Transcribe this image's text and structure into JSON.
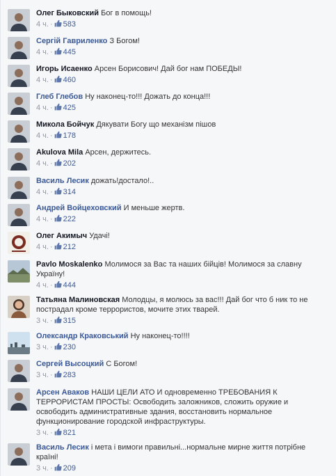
{
  "colors": {
    "link": "#3b5998",
    "text": "#333333",
    "meta": "#9197a3",
    "background": "#f6f7f8"
  },
  "comments": [
    {
      "author": "Олег Быковский",
      "text": "Бог в помощь!",
      "time": "4 ч.",
      "likes": "583",
      "avatar": "man-avatar"
    },
    {
      "author": "Сергій Гавриленко",
      "text": "З Богом!",
      "time": "4 ч.",
      "likes": "445",
      "avatar": "man-avatar"
    },
    {
      "author": "Игорь Исаенко",
      "text": "Арсен Борисович! Дай бог нам ПОБЕДЫ!",
      "time": "4 ч.",
      "likes": "460",
      "avatar": "man-avatar"
    },
    {
      "author": "Глеб Глебов",
      "text": "Ну наконец-то!!! Дожать до конца!!!",
      "time": "4 ч.",
      "likes": "425",
      "avatar": "man-avatar"
    },
    {
      "author": "Микола Бойчук",
      "text": "Дякувати Богу що механізм пішов",
      "time": "4 ч.",
      "likes": "178",
      "avatar": "man-avatar"
    },
    {
      "author": "Akulova Mila",
      "text": "Арсен, держитесь.",
      "time": "4 ч.",
      "likes": "202",
      "avatar": "man-avatar"
    },
    {
      "author": "Василь Лесик",
      "text": "дожать!достало!..",
      "time": "4 ч.",
      "likes": "314",
      "avatar": "man-avatar"
    },
    {
      "author": "Андрей Войцеховский",
      "text": "И меньше жертв.",
      "time": "4 ч.",
      "likes": "222",
      "avatar": "man-avatar"
    },
    {
      "author": "Олег Акимыч",
      "text": "Удачі!",
      "time": "4 ч.",
      "likes": "212",
      "avatar": "logo-avatar"
    },
    {
      "author": "Pavlo Moskalenko",
      "text": "Молимося за Вас та наших бійців! Молимося за славну Україну!",
      "time": "4 ч.",
      "likes": "444",
      "avatar": "landscape-avatar"
    },
    {
      "author": "Татьяна Малиновская",
      "text": "Молодцы, я молюсь за вас!!! Дай бог что б ник то не пострадал кроме террористов, мочите этих тварей.",
      "time": "3 ч.",
      "likes": "315",
      "avatar": "woman-avatar"
    },
    {
      "author": "Олександр Краковський",
      "text": "Ну наконец-то!!!!",
      "time": "3 ч.",
      "likes": "230",
      "avatar": "sky-avatar"
    },
    {
      "author": "Сергей Высоцкий",
      "text": "С Богом!",
      "time": "3 ч.",
      "likes": "283",
      "avatar": "man-avatar"
    },
    {
      "author": "Арсен Аваков",
      "text": "НАШИ ЦЕЛИ АТО И одновременно ТРЕБОВАНИЯ К ТЕРРОРИСТАМ ПРОСТЫ: Освободить заложников, сложить оружие и освободить административные здания, восстановить нормальное функционирование городской инфраструктуры.",
      "time": "3 ч.",
      "likes": "821",
      "avatar": "man-avatar"
    },
    {
      "author": "Василь Лесик",
      "text": "і мета і вимоги правильні...нормальне мирне життя потрібне країні!",
      "time": "3 ч.",
      "likes": "209",
      "avatar": "man-avatar"
    }
  ]
}
